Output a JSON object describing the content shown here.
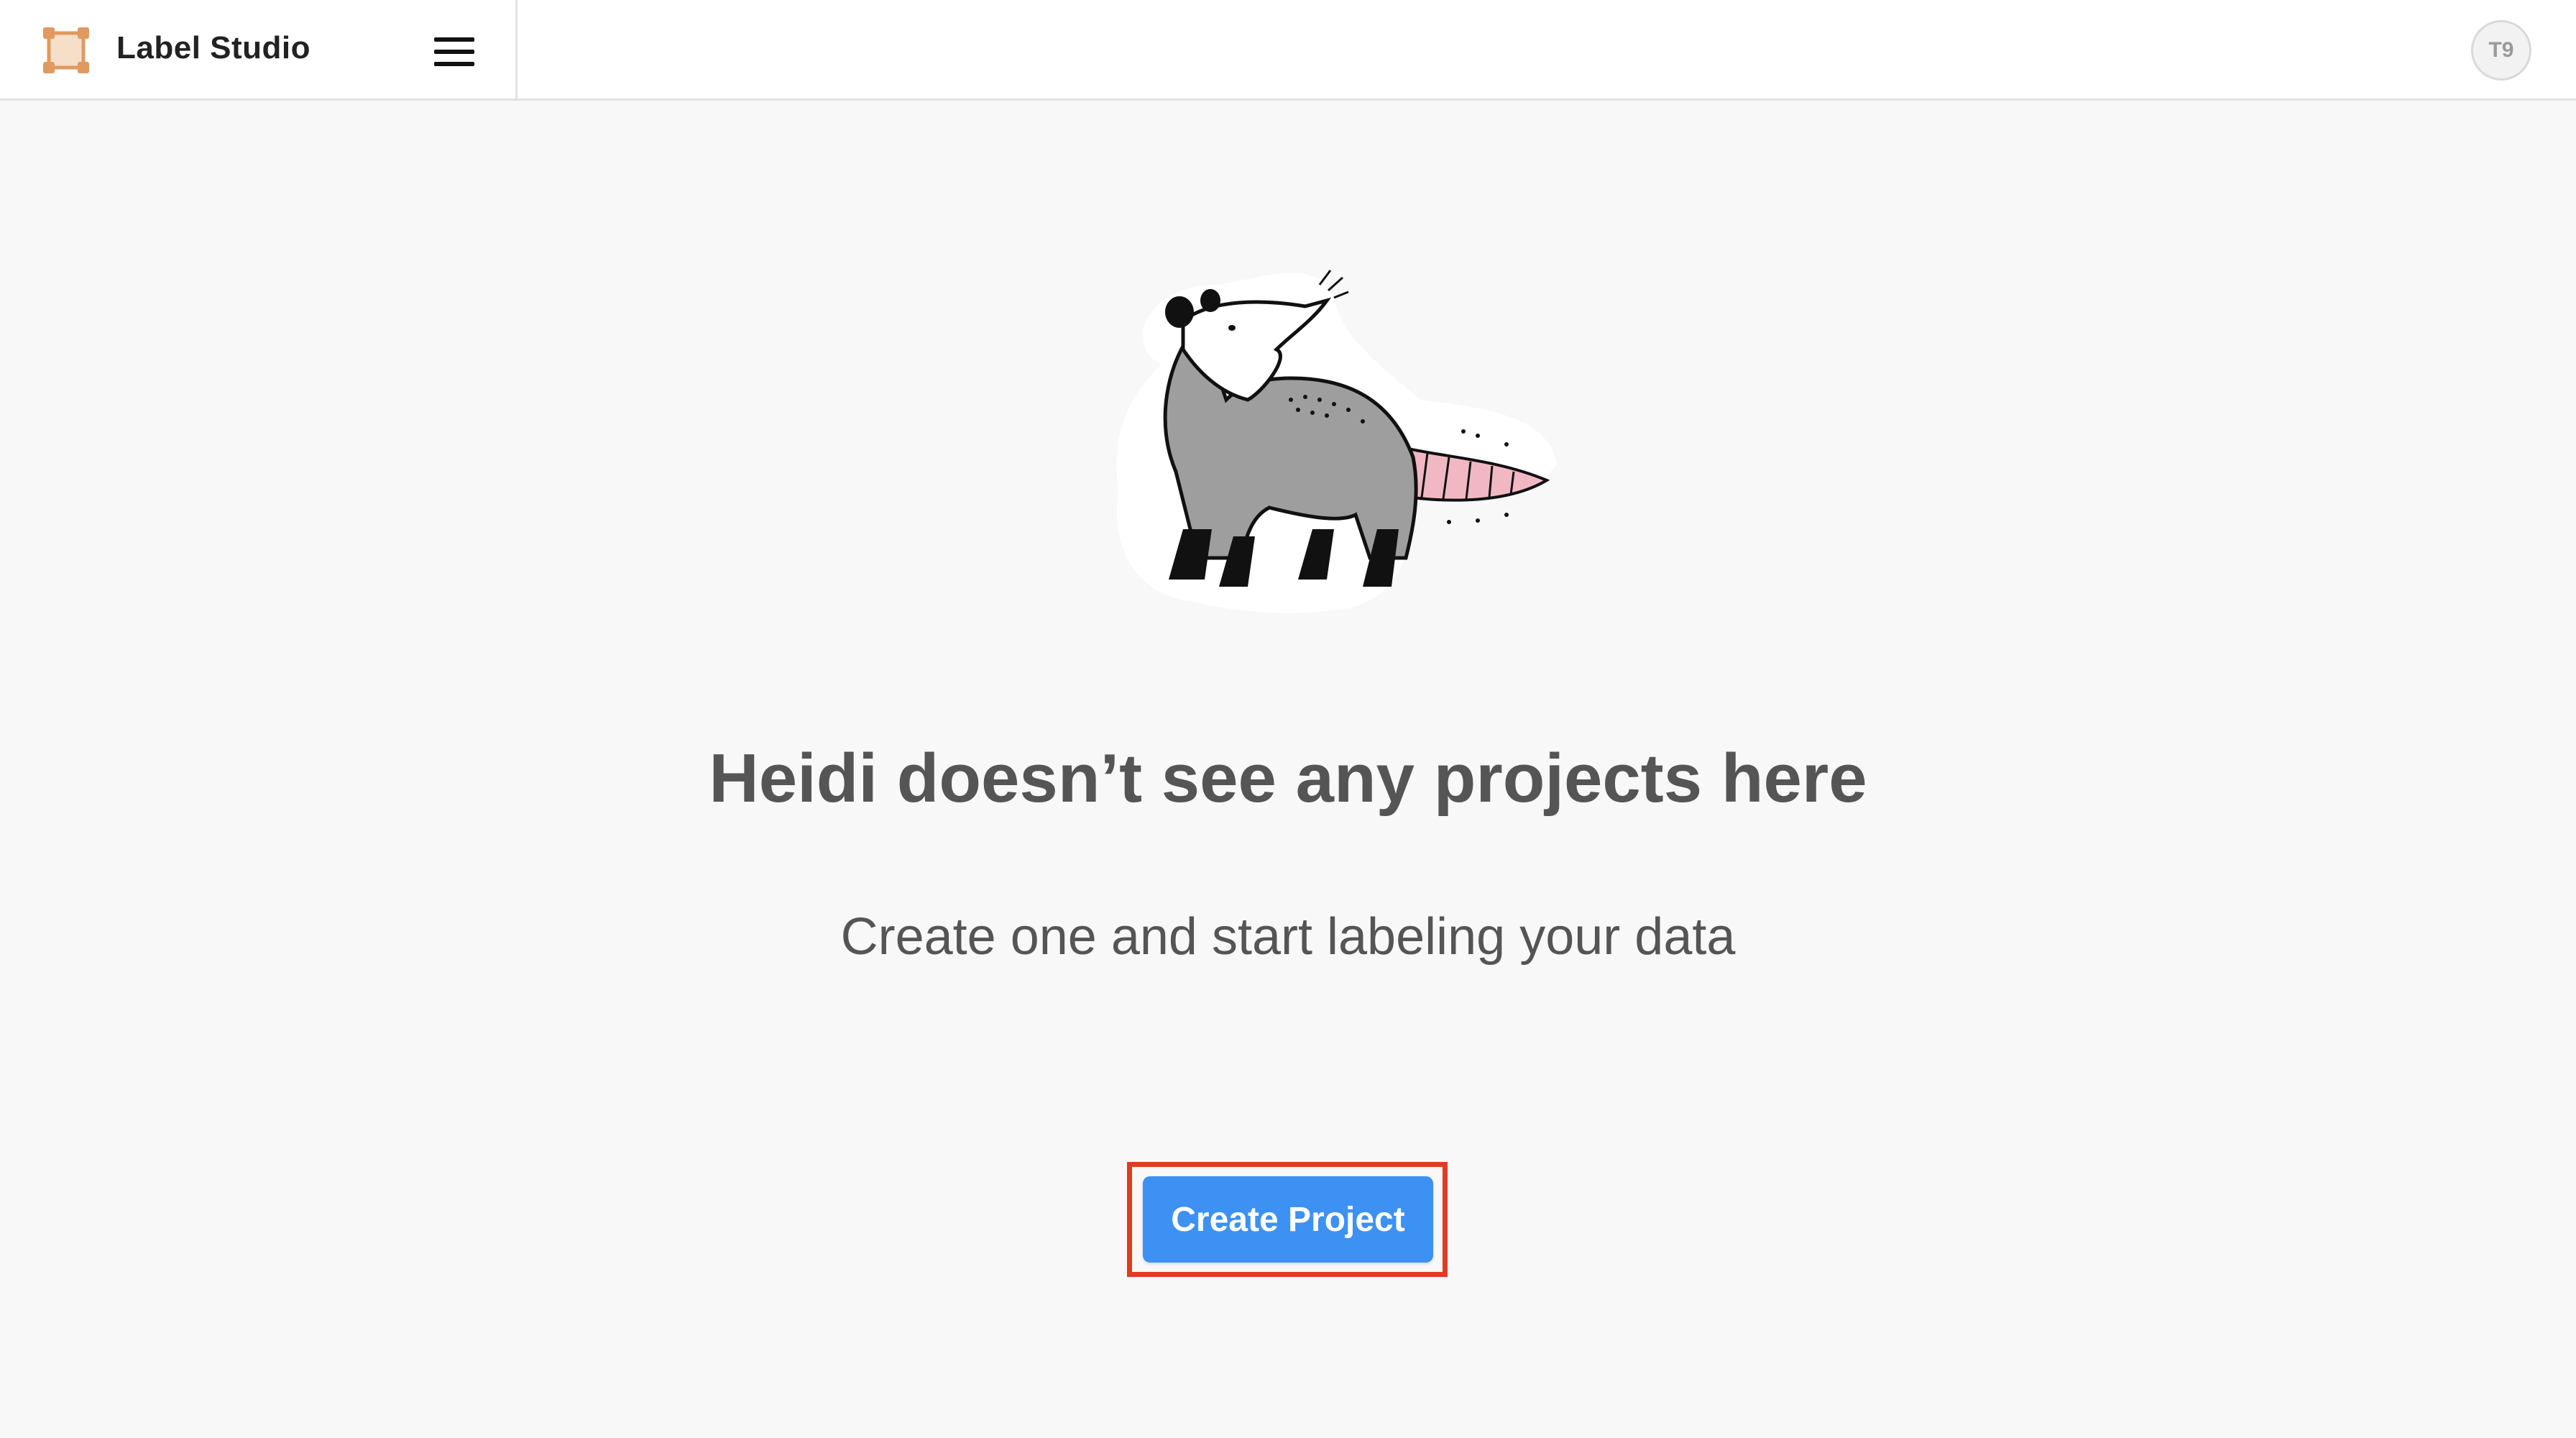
{
  "header": {
    "app_name": "Label Studio",
    "avatar_initials": "T9"
  },
  "empty_state": {
    "title": "Heidi doesn’t see any projects here",
    "subtitle": "Create one and start labeling your data",
    "create_button_label": "Create Project"
  },
  "colors": {
    "accent": "#3d91f2",
    "logo": "#e09a5f",
    "highlight": "#e03b24",
    "background": "#f8f8f8"
  },
  "icons": [
    "label-studio-logo-icon",
    "hamburger-menu-icon",
    "opossum-illustration"
  ]
}
